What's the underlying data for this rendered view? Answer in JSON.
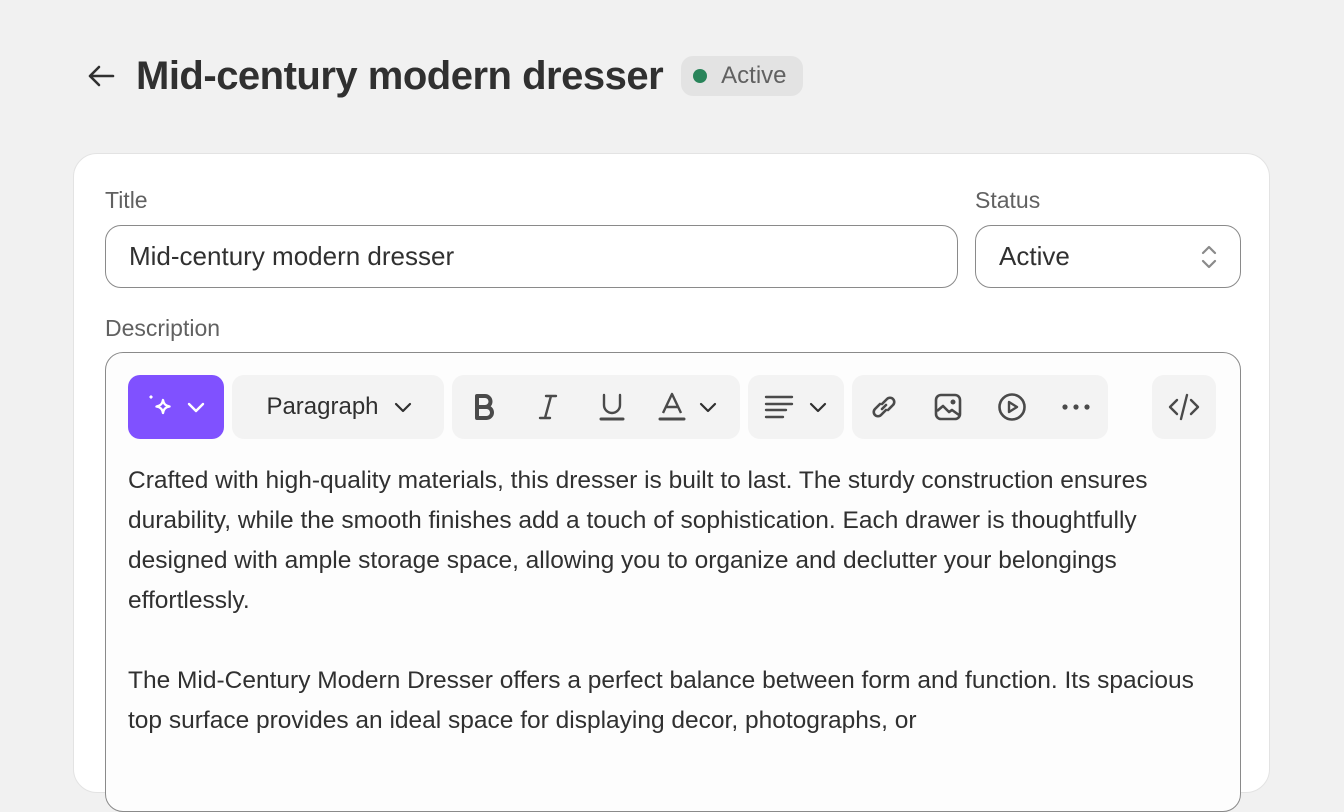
{
  "header": {
    "back_label": "Back",
    "title": "Mid-century modern dresser",
    "status_badge": "Active",
    "status_color": "#29845a"
  },
  "form": {
    "title_label": "Title",
    "title_value": "Mid-century modern dresser",
    "status_label": "Status",
    "status_value": "Active",
    "description_label": "Description"
  },
  "toolbar": {
    "ai_button": "sparkles-icon",
    "ai_color": "#8051ff",
    "paragraph_label": "Paragraph",
    "icons": [
      "bold-icon",
      "italic-icon",
      "underline-icon",
      "text-color-icon",
      "align-left-icon",
      "link-icon",
      "image-icon",
      "video-icon",
      "more-icon",
      "code-icon"
    ]
  },
  "description": {
    "paragraphs": [
      "Crafted with high-quality materials, this dresser is built to last. The sturdy construction ensures durability, while the smooth finishes add a touch of sophistication. Each drawer is thoughtfully designed with ample storage space, allowing you to organize and declutter your belongings effortlessly.",
      "The Mid-Century Modern Dresser offers a perfect balance between form and function. Its spacious top surface provides an ideal space for displaying decor, photographs, or"
    ]
  }
}
